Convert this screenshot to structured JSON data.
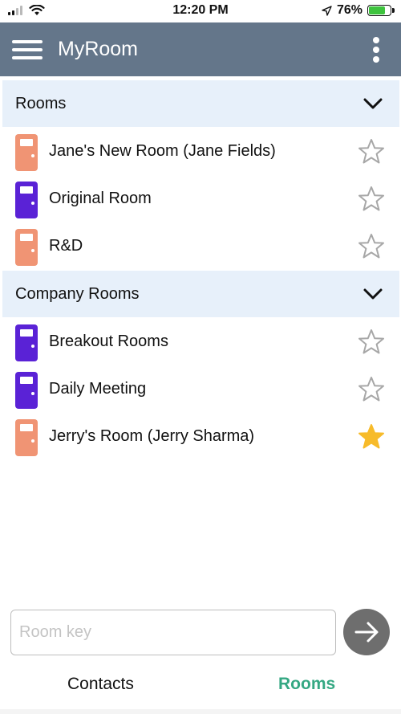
{
  "status_bar": {
    "time": "12:20 PM",
    "battery_percent": "76%",
    "battery_level": 0.76,
    "signal_bars_total": 4,
    "signal_bars_active": 2,
    "icons": [
      "signal-icon",
      "wifi-icon",
      "location-arrow-icon",
      "battery-charging-icon"
    ]
  },
  "app_bar": {
    "title": "MyRoom",
    "menu_icon": "hamburger-menu-icon",
    "overflow_icon": "more-vertical-icon"
  },
  "sections": [
    {
      "title": "Rooms",
      "expanded": true,
      "rooms": [
        {
          "name": "Jane's New Room (Jane Fields)",
          "door_color": "#f09474",
          "favorite": false
        },
        {
          "name": "Original Room",
          "door_color": "#5a22d6",
          "favorite": false
        },
        {
          "name": "R&D",
          "door_color": "#f09474",
          "favorite": false
        }
      ]
    },
    {
      "title": "Company Rooms",
      "expanded": true,
      "rooms": [
        {
          "name": "Breakout Rooms",
          "door_color": "#5a22d6",
          "favorite": false
        },
        {
          "name": "Daily Meeting",
          "door_color": "#5a22d6",
          "favorite": false
        },
        {
          "name": "Jerry's Room (Jerry Sharma)",
          "door_color": "#f09474",
          "favorite": true
        }
      ]
    }
  ],
  "room_key": {
    "placeholder": "Room key",
    "value": ""
  },
  "bottom_nav": {
    "tabs": [
      {
        "label": "Contacts",
        "active": false
      },
      {
        "label": "Rooms",
        "active": true
      }
    ]
  },
  "colors": {
    "app_bar": "#64768a",
    "section_header": "#e7f0fa",
    "door_orange": "#f09474",
    "door_purple": "#5a22d6",
    "star_favorite": "#f7bb2a",
    "star_outline": "#a7a7a7",
    "active_tab": "#35a883",
    "go_button": "#6e6e6e"
  }
}
